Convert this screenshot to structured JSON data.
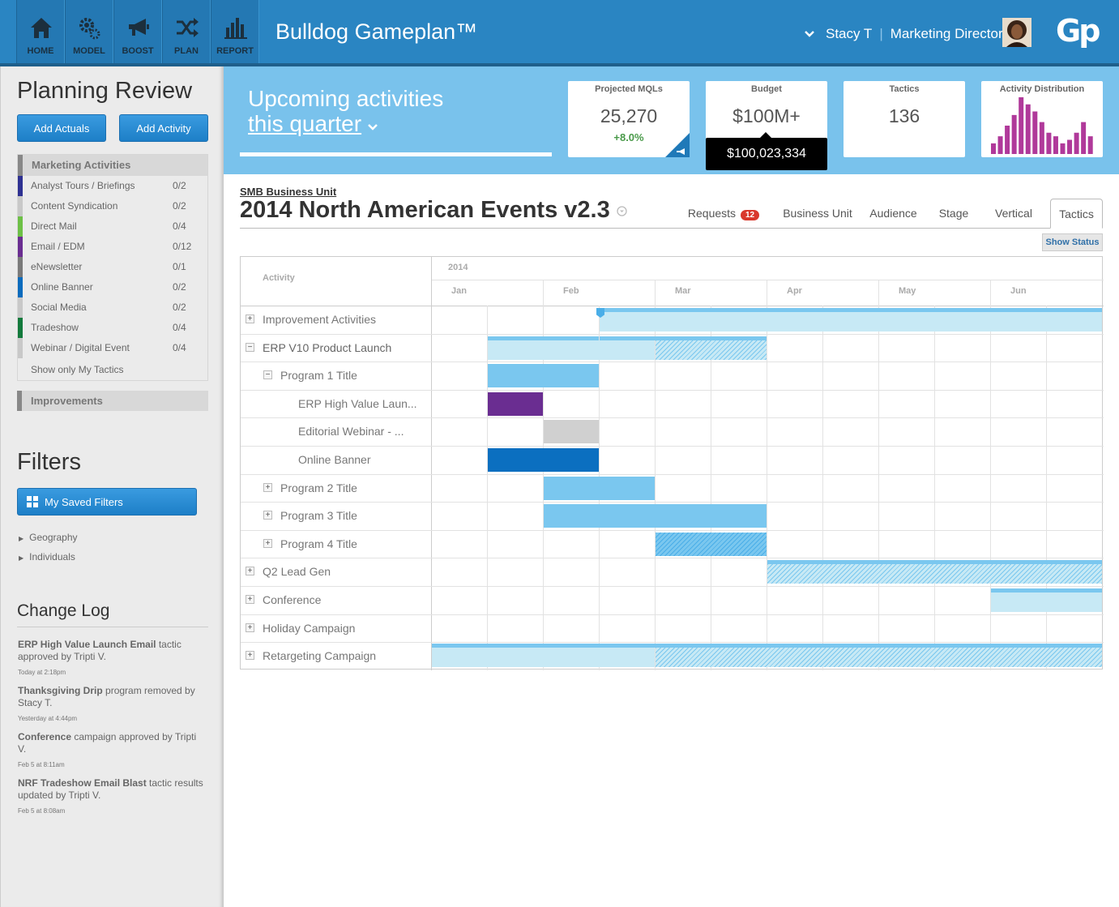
{
  "nav": [
    {
      "label": "HOME",
      "icon": "home-icon"
    },
    {
      "label": "MODEL",
      "icon": "gears-icon"
    },
    {
      "label": "BOOST",
      "icon": "megaphone-icon"
    },
    {
      "label": "PLAN",
      "icon": "shuffle-icon"
    },
    {
      "label": "REPORT",
      "icon": "bar-chart-icon"
    }
  ],
  "app_title": "Bulldog Gameplan™",
  "user": {
    "name": "Stacy T",
    "role": "Marketing Director"
  },
  "logo": "Gp",
  "sidebar": {
    "title": "Planning Review",
    "add_actuals": "Add Actuals",
    "add_activity": "Add Activity",
    "marketing_activities": "Marketing Activities",
    "items": [
      {
        "label": "Analyst Tours / Briefings",
        "count": "0/2",
        "color": "#2e3192"
      },
      {
        "label": "Content Syndication",
        "count": "0/2",
        "color": "#c8c8c8"
      },
      {
        "label": "Direct Mail",
        "count": "0/4",
        "color": "#6dc046"
      },
      {
        "label": "Email / EDM",
        "count": "0/12",
        "color": "#6a2d91"
      },
      {
        "label": "eNewsletter",
        "count": "0/1",
        "color": "#7a7a7a"
      },
      {
        "label": "Online Banner",
        "count": "0/2",
        "color": "#0a6bbd"
      },
      {
        "label": "Social Media",
        "count": "0/2",
        "color": "#c8c8c8"
      },
      {
        "label": "Tradeshow",
        "count": "0/4",
        "color": "#137a3c"
      },
      {
        "label": "Webinar / Digital Event",
        "count": "0/4",
        "color": "#c8c8c8"
      }
    ],
    "show_only": "Show only My Tactics",
    "improvements": "Improvements",
    "filters_title": "Filters",
    "saved_filters": "My Saved Filters",
    "filters": [
      "Geography",
      "Individuals"
    ],
    "changelog_title": "Change Log",
    "log": [
      {
        "bold": "ERP High Value Launch Email",
        "rest": " tactic approved by Tripti V.",
        "time": "Today at 2:18pm"
      },
      {
        "bold": "Thanksgiving Drip",
        "rest": " program removed by Stacy T.",
        "time": "Yesterday at 4:44pm"
      },
      {
        "bold": "Conference",
        "rest": " campaign approved by Tripti V.",
        "time": "Feb 5 at 8:11am"
      },
      {
        "bold": "NRF Tradeshow Email Blast",
        "rest": " tactic results updated by Tripti V.",
        "time": "Feb 5 at 8:08am"
      }
    ]
  },
  "hero": {
    "line1": "Upcoming activities",
    "line2": "this quarter"
  },
  "cards": {
    "mql": {
      "title": "Projected MQLs",
      "value": "25,270",
      "change": "+8.0%"
    },
    "budget": {
      "title": "Budget",
      "value": "$100M+",
      "tooltip": "$100,023,334"
    },
    "tactics": {
      "title": "Tactics",
      "value": "136"
    },
    "dist": {
      "title": "Activity Distribution",
      "values": [
        3,
        5,
        8,
        11,
        16,
        14,
        12,
        9,
        6,
        5,
        3,
        4,
        6,
        9,
        5
      ],
      "color": "#b0399a"
    }
  },
  "business_unit": "SMB Business Unit",
  "plan_title": "2014 North American Events v2.3",
  "tabs": {
    "requests": "Requests",
    "requests_count": "12",
    "business_unit": "Business Unit",
    "audience": "Audience",
    "stage": "Stage",
    "vertical": "Vertical",
    "tactics": "Tactics"
  },
  "show_status": "Show Status",
  "gantt": {
    "activity_header": "Activity",
    "year": "2014",
    "months": [
      "Jan",
      "Feb",
      "Mar",
      "Apr",
      "May",
      "Jun"
    ],
    "rows": [
      {
        "label": "Improvement Activities",
        "level": 0,
        "toggle": "+"
      },
      {
        "label": "ERP V10 Product Launch",
        "level": 0,
        "toggle": "−"
      },
      {
        "label": "Program 1 Title",
        "level": 1,
        "toggle": "−"
      },
      {
        "label": "ERP High Value Laun...",
        "level": 2,
        "toggle": ""
      },
      {
        "label": "Editorial Webinar - ...",
        "level": 2,
        "toggle": ""
      },
      {
        "label": "Online Banner",
        "level": 2,
        "toggle": ""
      },
      {
        "label": "Program 2 Title",
        "level": 1,
        "toggle": "+"
      },
      {
        "label": "Program 3 Title",
        "level": 1,
        "toggle": "+"
      },
      {
        "label": "Program 4 Title",
        "level": 1,
        "toggle": "+"
      },
      {
        "label": "Q2 Lead Gen",
        "level": 0,
        "toggle": "+"
      },
      {
        "label": "Conference",
        "level": 0,
        "toggle": "+"
      },
      {
        "label": "Holiday Campaign",
        "level": 0,
        "toggle": "+"
      },
      {
        "label": "Retargeting Campaign",
        "level": 0,
        "toggle": "+"
      }
    ]
  }
}
